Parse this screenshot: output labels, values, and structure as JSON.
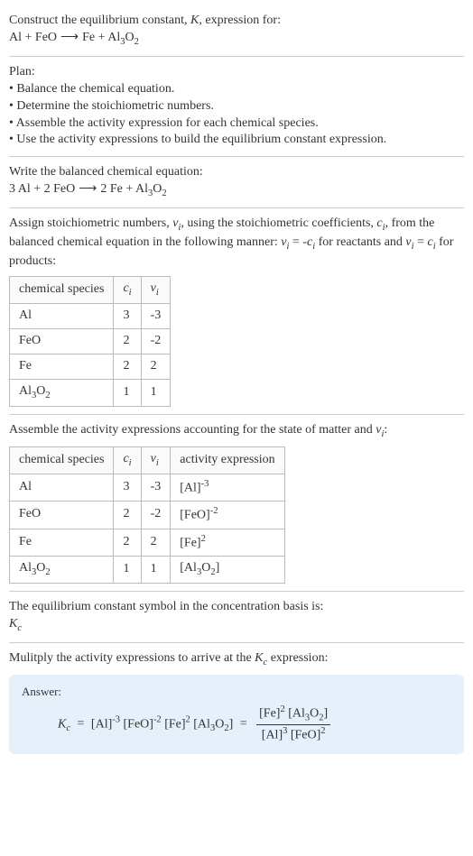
{
  "prompt": {
    "line1_a": "Construct the equilibrium constant, ",
    "line1_b": ", expression for:"
  },
  "eq_unbalanced": {
    "r1": "Al",
    "plus1": " + ",
    "r2": "FeO",
    "arrow": "⟶",
    "p1": "Fe",
    "plus2": " + ",
    "p2_a": "Al",
    "p2_sub1": "3",
    "p2_b": "O",
    "p2_sub2": "2"
  },
  "plan": {
    "title": "Plan:",
    "b1": "• Balance the chemical equation.",
    "b2": "• Determine the stoichiometric numbers.",
    "b3": "• Assemble the activity expression for each chemical species.",
    "b4": "• Use the activity expressions to build the equilibrium constant expression."
  },
  "balanced": {
    "intro": "Write the balanced chemical equation:",
    "c1": "3 ",
    "r1": "Al",
    "plus1": " + ",
    "c2": "2 ",
    "r2": "FeO",
    "arrow": "⟶",
    "c3": "2 ",
    "p1": "Fe",
    "plus2": " + ",
    "p2_a": "Al",
    "p2_sub1": "3",
    "p2_b": "O",
    "p2_sub2": "2"
  },
  "stoich": {
    "intro_a": "Assign stoichiometric numbers, ",
    "intro_b": ", using the stoichiometric coefficients, ",
    "intro_c": ", from the balanced chemical equation in the following manner: ",
    "intro_d": " for reactants and ",
    "intro_e": " for products:",
    "nu": "ν",
    "ci": "c",
    "sub_i": "i",
    "eq1_lhs": "ν",
    "eq1_mid": " = -",
    "eq1_rhs": "c",
    "eq2_lhs": "ν",
    "eq2_mid": " = ",
    "eq2_rhs": "c",
    "headers": {
      "h1": "chemical species",
      "h2": "c",
      "h3": "ν"
    },
    "rows": [
      {
        "sp": "Al",
        "c": "3",
        "v": "-3"
      },
      {
        "sp": "FeO",
        "c": "2",
        "v": "-2"
      },
      {
        "sp": "Fe",
        "c": "2",
        "v": "2"
      },
      {
        "sp_a": "Al",
        "sp_s1": "3",
        "sp_b": "O",
        "sp_s2": "2",
        "c": "1",
        "v": "1"
      }
    ]
  },
  "activity": {
    "intro_a": "Assemble the activity expressions accounting for the state of matter and ",
    "intro_b": ":",
    "headers": {
      "h1": "chemical species",
      "h2": "c",
      "h3": "ν",
      "h4": "activity expression"
    },
    "rows": [
      {
        "sp": "Al",
        "c": "3",
        "v": "-3",
        "ae_base": "[Al]",
        "ae_exp": "-3"
      },
      {
        "sp": "FeO",
        "c": "2",
        "v": "-2",
        "ae_base": "[FeO]",
        "ae_exp": "-2"
      },
      {
        "sp": "Fe",
        "c": "2",
        "v": "2",
        "ae_base": "[Fe]",
        "ae_exp": "2"
      },
      {
        "sp_a": "Al",
        "sp_s1": "3",
        "sp_b": "O",
        "sp_s2": "2",
        "c": "1",
        "v": "1",
        "ae_base_a": "[Al",
        "ae_sub1": "3",
        "ae_base_b": "O",
        "ae_sub2": "2",
        "ae_base_c": "]"
      }
    ]
  },
  "symbol": {
    "intro": "The equilibrium constant symbol in the concentration basis is:",
    "K": "K",
    "sub": "c"
  },
  "multiply": {
    "intro_a": "Mulitply the activity expressions to arrive at the ",
    "intro_b": " expression:"
  },
  "answer": {
    "label": "Answer:",
    "K": "K",
    "Ksub": "c",
    "eq": " = ",
    "t1": "[Al]",
    "e1": "-3",
    "sp": " ",
    "t2": "[FeO]",
    "e2": "-2",
    "t3": "[Fe]",
    "e3": "2",
    "t4a": "[Al",
    "t4s1": "3",
    "t4b": "O",
    "t4s2": "2",
    "t4c": "]",
    "eq2": " = ",
    "num_a": "[Fe]",
    "num_e": "2",
    "num_sp": " ",
    "num_b_a": "[Al",
    "num_b_s1": "3",
    "num_b_b": "O",
    "num_b_s2": "2",
    "num_b_c": "]",
    "den_a": "[Al]",
    "den_e1": "3",
    "den_sp": " ",
    "den_b": "[FeO]",
    "den_e2": "2"
  }
}
